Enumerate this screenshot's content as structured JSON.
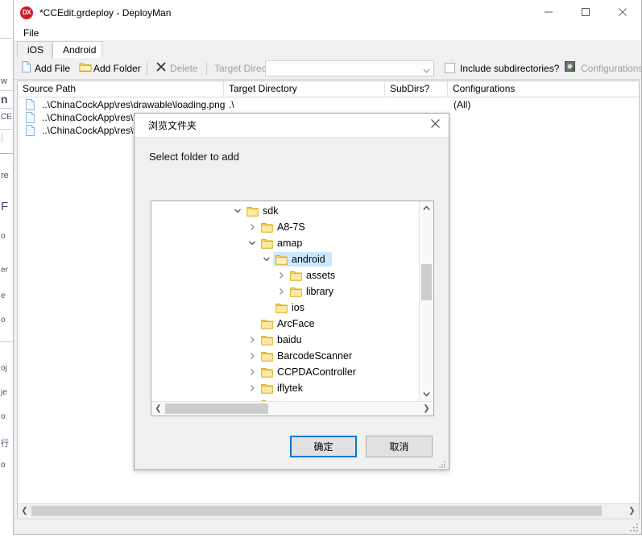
{
  "window": {
    "title": "*CCEdit.grdeploy - DeployMan",
    "app_icon": "deployman-icon",
    "controls": {
      "minimize": "minimize-icon",
      "maximize": "maximize-icon",
      "close": "close-icon"
    }
  },
  "menubar": {
    "items": [
      {
        "label": "File"
      }
    ]
  },
  "tabs": [
    {
      "label": "iOS",
      "active": false
    },
    {
      "label": "Android",
      "active": true
    }
  ],
  "toolbar": {
    "add_file": "Add File",
    "add_folder": "Add Folder",
    "delete": "Delete",
    "target_directory_label": "Target Directory:",
    "target_directory_value": "",
    "include_subdirectories": "Include subdirectories?",
    "include_subdirectories_checked": false,
    "configurations": "Configurations"
  },
  "table": {
    "columns": [
      "Source Path",
      "Target Directory",
      "SubDirs?",
      "Configurations"
    ],
    "rows": [
      {
        "source_path": "..\\ChinaCockApp\\res\\drawable\\loading.png",
        "target_directory": ".\\",
        "subdirs": "",
        "configurations": "(All)"
      },
      {
        "source_path": "..\\ChinaCockApp\\res\\value",
        "target_directory": "",
        "subdirs": "",
        "configurations": ""
      },
      {
        "source_path": "..\\ChinaCockApp\\res\\value",
        "target_directory": "",
        "subdirs": "",
        "configurations": ""
      }
    ]
  },
  "dialog": {
    "title": "浏览文件夹",
    "prompt": "Select folder to add",
    "close_icon": "close-icon",
    "ok_label": "确定",
    "cancel_label": "取消",
    "tree": [
      {
        "label": "sdk",
        "depth": 0,
        "expander": "down",
        "selected": false
      },
      {
        "label": "A8-7S",
        "depth": 1,
        "expander": "right",
        "selected": false
      },
      {
        "label": "amap",
        "depth": 1,
        "expander": "down",
        "selected": false
      },
      {
        "label": "android",
        "depth": 2,
        "expander": "down",
        "selected": true
      },
      {
        "label": "assets",
        "depth": 3,
        "expander": "right",
        "selected": false
      },
      {
        "label": "library",
        "depth": 3,
        "expander": "right",
        "selected": false
      },
      {
        "label": "ios",
        "depth": 3,
        "expander": "none",
        "selected": false
      },
      {
        "label": "ArcFace",
        "depth": 2,
        "expander": "none",
        "selected": false
      },
      {
        "label": "baidu",
        "depth": 1,
        "expander": "right",
        "selected": false
      },
      {
        "label": "BarcodeScanner",
        "depth": 1,
        "expander": "right",
        "selected": false
      },
      {
        "label": "CCPDAController",
        "depth": 1,
        "expander": "right",
        "selected": false
      },
      {
        "label": "iflytek",
        "depth": 1,
        "expander": "right",
        "selected": false
      }
    ]
  },
  "colors": {
    "accent": "#0078d7",
    "selection": "#cce8ff",
    "folder": "#ffd966",
    "window_bg": "#f0f0f0",
    "brand_red": "#d11a2a"
  }
}
